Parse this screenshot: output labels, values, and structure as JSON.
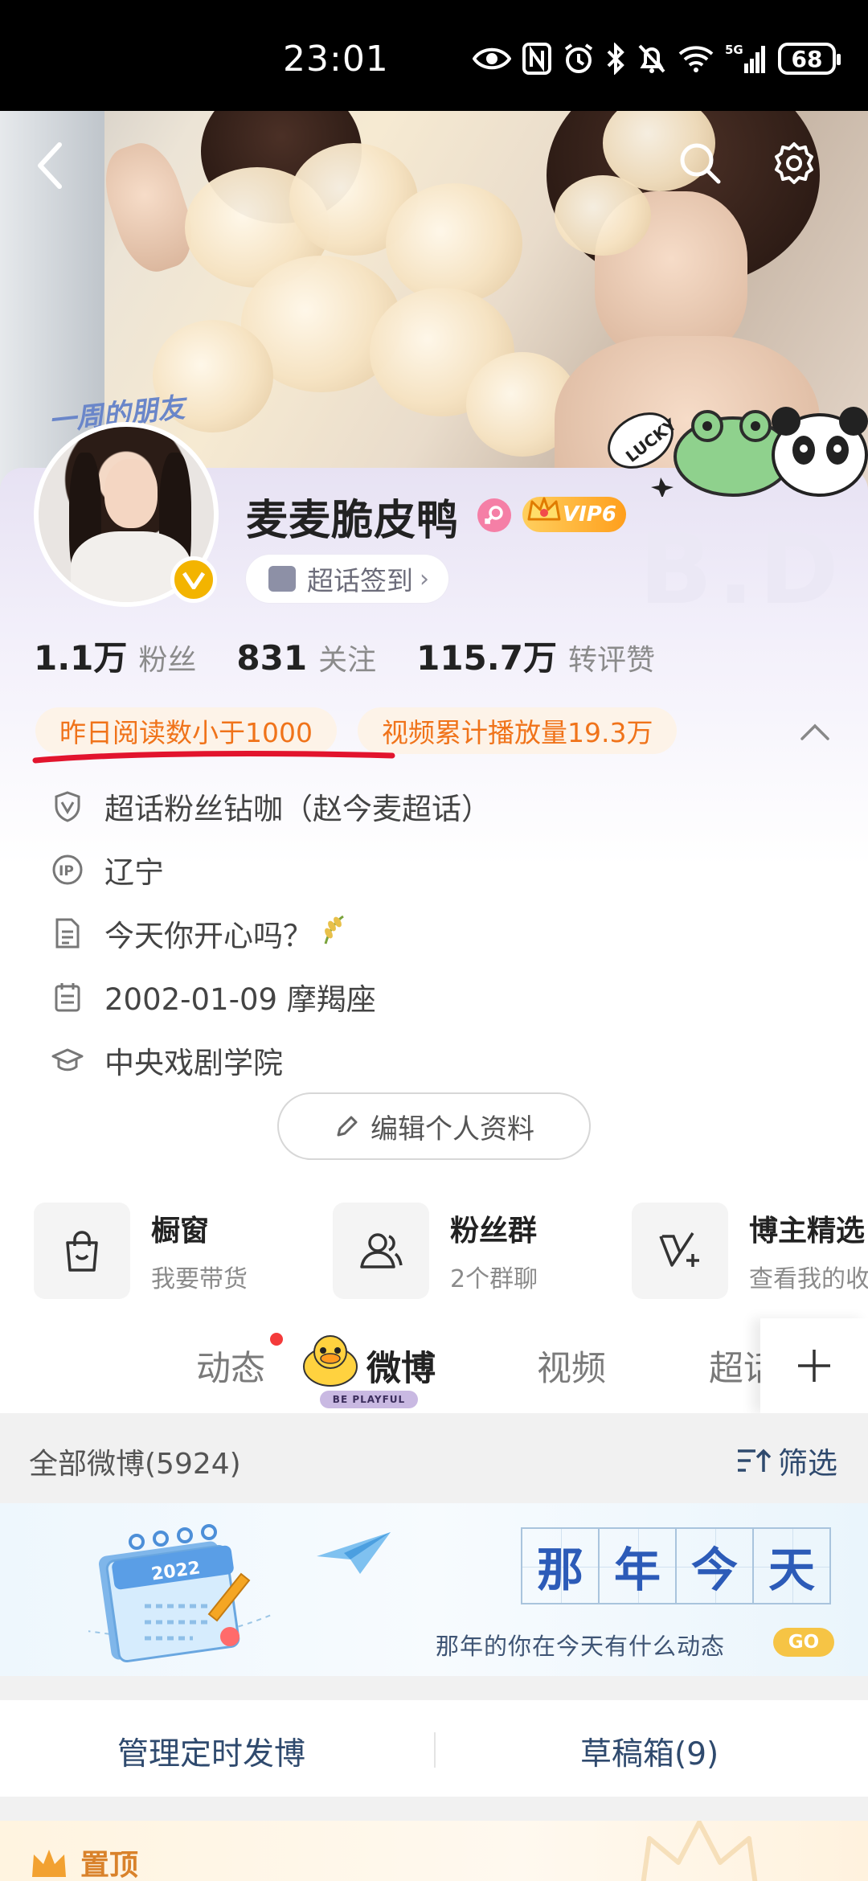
{
  "status_bar": {
    "time": "23:01",
    "battery": "68",
    "network": "5G"
  },
  "cover": {
    "sticker_text": "一周的朋友",
    "lucky_text": "LUCKY"
  },
  "profile": {
    "username": "麦麦脆皮鸭",
    "vip_label": "VIP6",
    "checkin_label": "超话签到",
    "stats": [
      {
        "value": "1.1万",
        "label": "粉丝"
      },
      {
        "value": "831",
        "label": "关注"
      },
      {
        "value": "115.7万",
        "label": "转评赞"
      }
    ],
    "tags": [
      "昨日阅读数小于1000",
      "视频累计播放量19.3万"
    ],
    "info": [
      {
        "icon": "shield-v-icon",
        "text": "超话粉丝钻咖（赵今麦超话）"
      },
      {
        "icon": "ip-icon",
        "text": "辽宁"
      },
      {
        "icon": "document-icon",
        "text": "今天你开心吗？"
      },
      {
        "icon": "calendar-icon",
        "text": "2002-01-09 摩羯座"
      },
      {
        "icon": "graduation-cap-icon",
        "text": "中央戏剧学院"
      }
    ],
    "edit_label": "编辑个人资料",
    "watermark": "B.D"
  },
  "features": [
    {
      "icon": "shopping-bag-icon",
      "title": "橱窗",
      "subtitle": "我要带货"
    },
    {
      "icon": "group-icon",
      "title": "粉丝群",
      "subtitle": "2个群聊"
    },
    {
      "icon": "check-plus-icon",
      "title": "博主精选",
      "subtitle": "查看我的收"
    }
  ],
  "tabs": [
    {
      "label": "动态",
      "active": false
    },
    {
      "label": "微博",
      "active": true
    },
    {
      "label": "视频",
      "active": false
    },
    {
      "label": "超话",
      "active": false
    }
  ],
  "tab_badge_text": "BE PLAYFUL",
  "feed": {
    "count_label": "全部微博(5924)",
    "filter_label": "筛选"
  },
  "banner": {
    "title_chars": [
      "那",
      "年",
      "今",
      "天"
    ],
    "subtitle": "那年的你在今天有什么动态",
    "go_label": "GO",
    "year": "2022"
  },
  "actions": {
    "schedule_label": "管理定时发博",
    "drafts_label": "草稿箱(9)"
  },
  "pinned": {
    "label": "置顶"
  },
  "colors": {
    "accent_orange": "#f0731a",
    "link_blue": "#2f4a6e",
    "vip_gold": "#ff9f1c",
    "verified": "#f3b400"
  }
}
